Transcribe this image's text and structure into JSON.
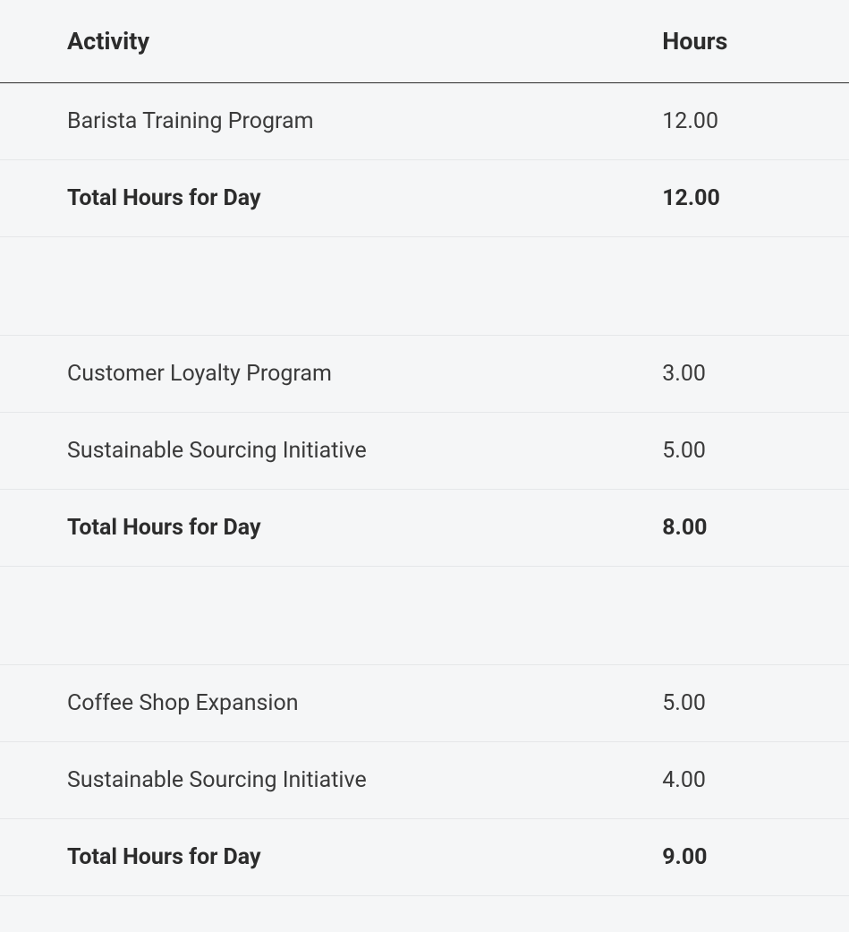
{
  "headers": {
    "activity": "Activity",
    "hours": "Hours"
  },
  "groups": [
    {
      "rows": [
        {
          "activity": "Barista Training Program",
          "hours": "12.00"
        }
      ],
      "total": {
        "label": "Total Hours for Day",
        "hours": "12.00"
      }
    },
    {
      "rows": [
        {
          "activity": "Customer Loyalty Program",
          "hours": "3.00"
        },
        {
          "activity": "Sustainable Sourcing Initiative",
          "hours": "5.00"
        }
      ],
      "total": {
        "label": "Total Hours for Day",
        "hours": "8.00"
      }
    },
    {
      "rows": [
        {
          "activity": "Coffee Shop Expansion",
          "hours": "5.00"
        },
        {
          "activity": "Sustainable Sourcing Initiative",
          "hours": "4.00"
        }
      ],
      "total": {
        "label": "Total Hours for Day",
        "hours": "9.00"
      }
    }
  ]
}
